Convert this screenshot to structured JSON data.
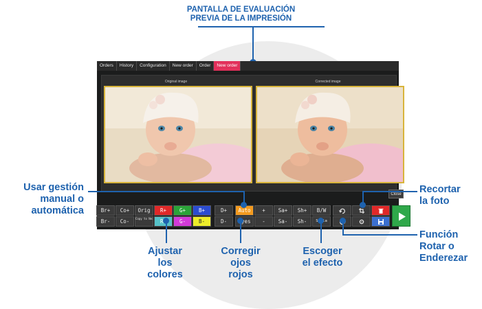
{
  "title": {
    "line1": "PANTALLA DE EVALUACIÓN",
    "line2": "PREVIA DE LA IMPRESIÓN"
  },
  "tabs": [
    "Orders",
    "History",
    "Configuration",
    "New order",
    "Order",
    "New order"
  ],
  "active_tab_index": 5,
  "panel": {
    "original_label": "Original image",
    "corrected_label": "Corrected image",
    "close_label": "Close"
  },
  "toolbar": {
    "row1": [
      "Br+",
      "Co+",
      "Orig",
      "R+",
      "G+",
      "B+",
      "D+",
      "Auto",
      "+",
      "Sa+",
      "Sh+",
      "B/W",
      "rotate-icon",
      "crop-icon",
      "delete-icon"
    ],
    "row2": [
      "Br-",
      "Co-",
      "Copy to Next",
      "R-",
      "G-",
      "B-",
      "D-",
      "Eyes",
      "-",
      "Sa-",
      "Sh-",
      "Sepia",
      "rotate-ccw-icon",
      "settings-icon",
      "save-icon"
    ],
    "play_icon": "play-icon"
  },
  "annotations": {
    "gestion": [
      "Usar gestión",
      "manual o",
      "automática"
    ],
    "colores": [
      "Ajustar",
      "los",
      "colores"
    ],
    "ojos": [
      "Corregir",
      "ojos",
      "rojos"
    ],
    "efecto": [
      "Escoger",
      "el efecto"
    ],
    "recortar": [
      "Recortar",
      "la foto"
    ],
    "rotar": [
      "Función",
      "Rotar o",
      "Enderezar"
    ]
  },
  "colors": {
    "accent_blue": "#1e62ae",
    "tab_active": "#e2305b",
    "photo_border": "#d8b43a",
    "red": "#e02828",
    "green": "#2aa338",
    "blue": "#2b4cd0",
    "orange": "#f39a1e",
    "teal": "#56c2c8",
    "magenta": "#d23ad8",
    "yellow": "#eded2a",
    "play_green": "#2fa84a"
  }
}
